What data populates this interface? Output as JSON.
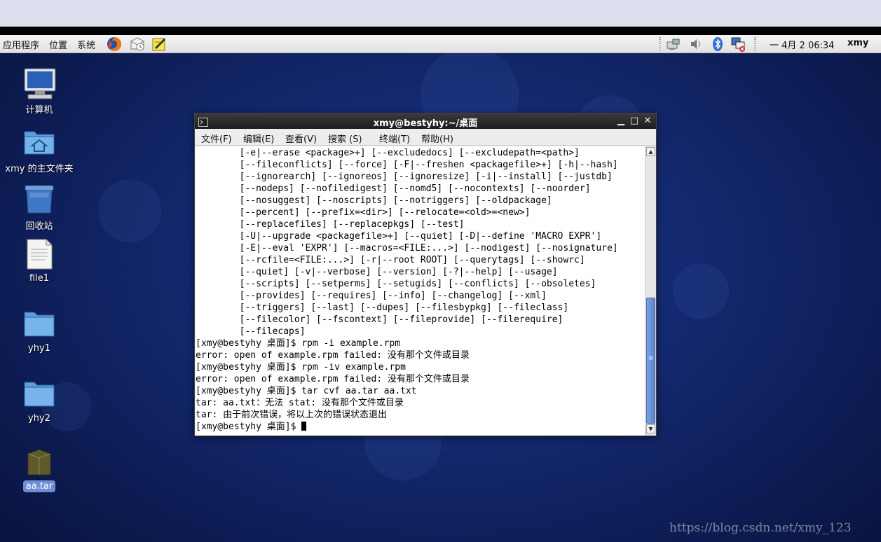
{
  "panel": {
    "menus": [
      "应用程序",
      "位置",
      "系统"
    ],
    "launchers": [
      "firefox-icon",
      "mail-icon",
      "notes-icon"
    ],
    "tray_icons": [
      "network-icon",
      "volume-icon",
      "bluetooth-icon",
      "display-icon"
    ],
    "clock": "一 4月  2 06:34",
    "user": "xmy"
  },
  "desktop": {
    "icons": [
      {
        "label": "计算机",
        "icon": "computer-icon"
      },
      {
        "label": "xmy 的主文件夹",
        "icon": "home-folder-icon"
      },
      {
        "label": "回收站",
        "icon": "trash-icon"
      },
      {
        "label": "file1",
        "icon": "text-file-icon"
      },
      {
        "label": "yhy1",
        "icon": "folder-icon"
      },
      {
        "label": "yhy2",
        "icon": "folder-icon"
      },
      {
        "label": "aa.tar",
        "icon": "archive-icon",
        "selected": true
      }
    ]
  },
  "terminal": {
    "title": "xmy@bestyhy:~/桌面",
    "menu": [
      "文件(F)",
      "编辑(E)",
      "查看(V)",
      "搜索 (S)",
      "终端(T)",
      "帮助(H)"
    ],
    "lines": [
      "        [-e|--erase <package>+] [--excludedocs] [--excludepath=<path>]",
      "        [--fileconflicts] [--force] [-F|--freshen <packagefile>+] [-h|--hash]",
      "        [--ignorearch] [--ignoreos] [--ignoresize] [-i|--install] [--justdb]",
      "        [--nodeps] [--nofiledigest] [--nomd5] [--nocontexts] [--noorder]",
      "        [--nosuggest] [--noscripts] [--notriggers] [--oldpackage]",
      "        [--percent] [--prefix=<dir>] [--relocate=<old>=<new>]",
      "        [--replacefiles] [--replacepkgs] [--test]",
      "        [-U|--upgrade <packagefile>+] [--quiet] [-D|--define 'MACRO EXPR']",
      "        [-E|--eval 'EXPR'] [--macros=<FILE:...>] [--nodigest] [--nosignature]",
      "        [--rcfile=<FILE:...>] [-r|--root ROOT] [--querytags] [--showrc]",
      "        [--quiet] [-v|--verbose] [--version] [-?|--help] [--usage]",
      "        [--scripts] [--setperms] [--setugids] [--conflicts] [--obsoletes]",
      "        [--provides] [--requires] [--info] [--changelog] [--xml]",
      "        [--triggers] [--last] [--dupes] [--filesbypkg] [--fileclass]",
      "        [--filecolor] [--fscontext] [--fileprovide] [--filerequire]",
      "        [--filecaps]",
      "[xmy@bestyhy 桌面]$ rpm -i example.rpm",
      "error: open of example.rpm failed: 没有那个文件或目录",
      "[xmy@bestyhy 桌面]$ rpm -iv example.rpm",
      "error: open of example.rpm failed: 没有那个文件或目录",
      "[xmy@bestyhy 桌面]$ tar cvf aa.tar aa.txt",
      "tar: aa.txt：无法 stat: 没有那个文件或目录",
      "tar: 由于前次错误，将以上次的错误状态退出"
    ],
    "prompt": "[xmy@bestyhy 桌面]$ "
  },
  "watermark": "https://blog.csdn.net/xmy_123"
}
